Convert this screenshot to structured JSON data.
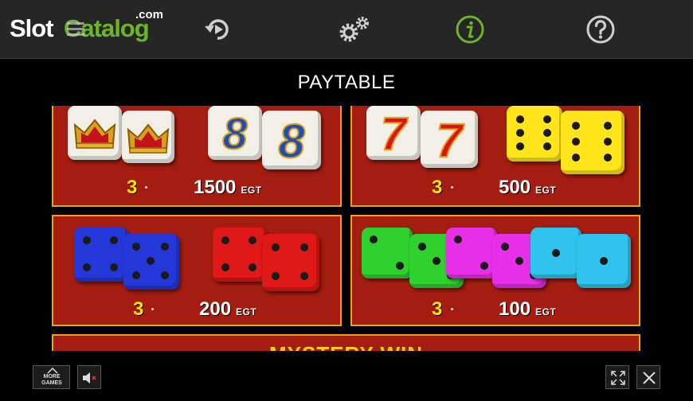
{
  "brand": {
    "part1": "Slot",
    "part2": "Catalog",
    "suffix": ".com"
  },
  "nav": [
    {
      "name": "history-icon"
    },
    {
      "name": "settings-icon"
    },
    {
      "name": "info-icon"
    },
    {
      "name": "help-icon"
    }
  ],
  "paytable_title": "PAYTABLE",
  "payouts": [
    {
      "count": "3",
      "amount": "1500",
      "unit": "EGT"
    },
    {
      "count": "3",
      "amount": "500",
      "unit": "EGT"
    },
    {
      "count": "3",
      "amount": "200",
      "unit": "EGT"
    },
    {
      "count": "3",
      "amount": "100",
      "unit": "EGT"
    }
  ],
  "mystery_label": "MYSTERY WIN",
  "bottom": {
    "more_games": "MORE GAMES"
  },
  "colors": {
    "panel": "#a51d10",
    "border": "#e8a020",
    "accent": "#6bb52d",
    "count": "#ffe400"
  }
}
